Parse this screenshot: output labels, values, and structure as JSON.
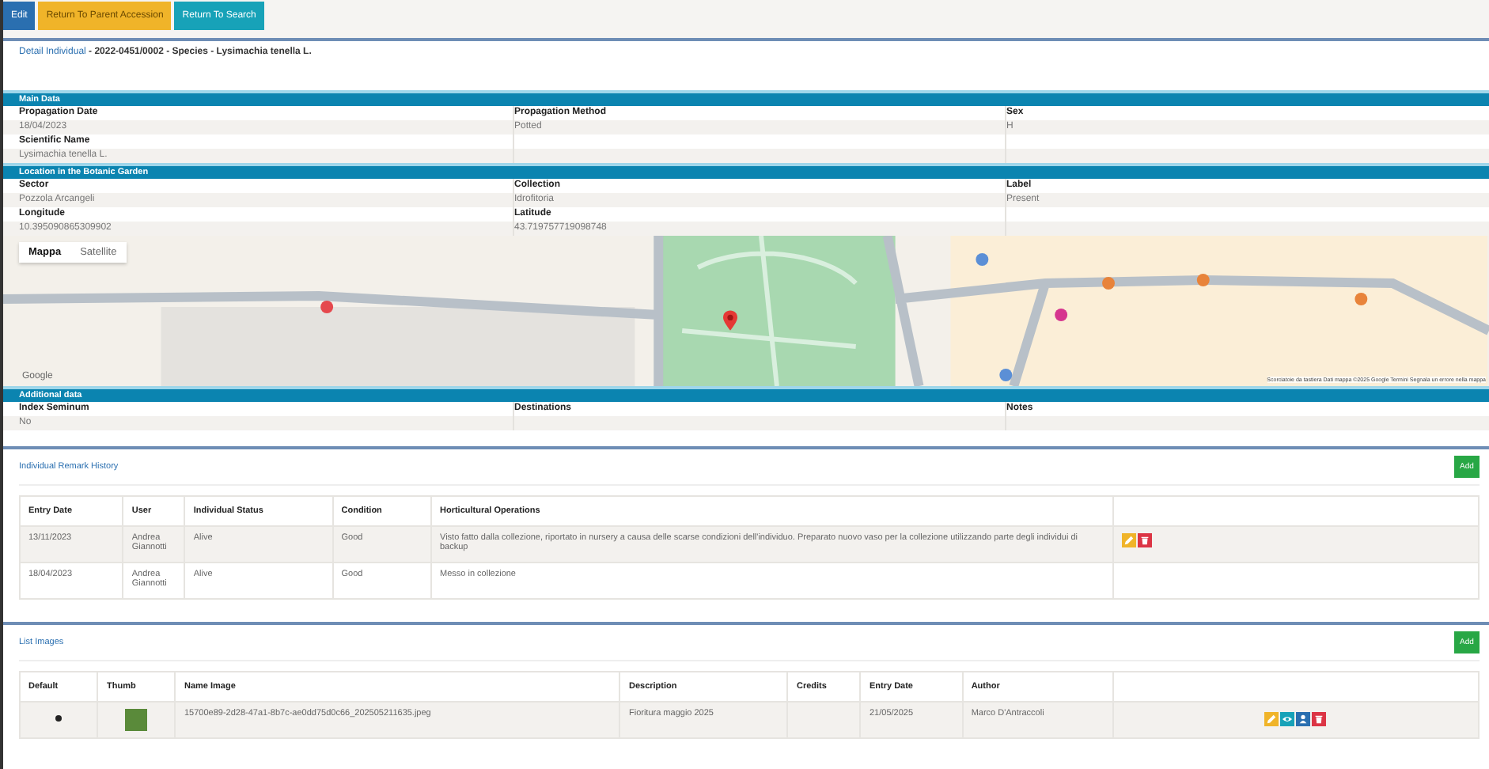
{
  "toolbar": [
    {
      "label": "Edit",
      "kind": "primary"
    },
    {
      "label": "Return To Parent Accession",
      "kind": "warning"
    },
    {
      "label": "Return To Search",
      "kind": "info"
    }
  ],
  "title": {
    "link": "Detail Individual",
    "text": " - 2022-0451/0002 - Species - Lysimachia tenella L."
  },
  "sections": [
    {
      "title": "Main Data",
      "rows": [
        [
          {
            "label": "Propagation Date",
            "value": "18/04/2023"
          },
          {
            "label": "Propagation Method",
            "value": "Potted"
          },
          {
            "label": "Sex",
            "value": "H"
          }
        ],
        [
          {
            "label": "Scientific Name",
            "value": "Lysimachia tenella L."
          },
          {},
          {}
        ]
      ]
    },
    {
      "title": "Location in the Botanic Garden",
      "rows": [
        [
          {
            "label": "Sector",
            "value": "Pozzola Arcangeli"
          },
          {
            "label": "Collection",
            "value": "Idrofitoria"
          },
          {
            "label": "Label",
            "value": "Present"
          }
        ],
        [
          {
            "label": "Longitude",
            "value": "10.395090865309902"
          },
          {
            "label": "Latitude",
            "value": "43.719757719098748"
          },
          {}
        ]
      ],
      "map": {
        "tabs": [
          {
            "label": "Mappa",
            "selected": true
          },
          {
            "label": "Satellite",
            "selected": false
          }
        ],
        "logo": "Google",
        "attribution": "Scorciatoie da tastiera   Dati mappa ©2025 Google   Termini   Segnala un errore nella mappa"
      }
    },
    {
      "title": "Additional data",
      "rows": [
        [
          {
            "label": "Index Seminum",
            "value": "No"
          },
          {
            "label": "Destinations"
          },
          {
            "label": "Notes"
          }
        ]
      ]
    }
  ],
  "history": {
    "title": "Individual Remark History",
    "add": "Add",
    "columns": [
      "Entry Date",
      "User",
      "Individual Status",
      "Condition",
      "Horticultural Operations"
    ],
    "rows": [
      {
        "cells": [
          "13/11/2023",
          "Andrea Giannotti",
          "Alive",
          "Good",
          "Visto fatto dalla collezione, riportato in nursery a causa delle scarse condizioni dell'individuo. Preparato nuovo vaso per la collezione utilizzando parte degli individui di backup"
        ],
        "actions": [
          {
            "kind": "edit"
          },
          {
            "kind": "delete"
          }
        ]
      },
      {
        "cells": [
          "18/04/2023",
          "Andrea Giannotti",
          "Alive",
          "Good",
          "Messo in collezione"
        ],
        "actions": []
      }
    ]
  },
  "images": {
    "title": "List Images",
    "add": "Add",
    "columns": [
      "Default",
      "Thumb",
      "Name Image",
      "Description",
      "Credits",
      "Entry Date",
      "Author"
    ],
    "rows": [
      {
        "default": true,
        "name": "15700e89-2d28-47a1-8b7c-ae0dd75d0c66_202505211635.jpeg",
        "description": "Fioritura maggio 2025",
        "date": "21/05/2025",
        "author": "Marco D'Antraccoli",
        "actions": [
          {
            "kind": "edit"
          },
          {
            "kind": "view"
          },
          {
            "kind": "user"
          },
          {
            "kind": "delete"
          }
        ]
      }
    ]
  }
}
